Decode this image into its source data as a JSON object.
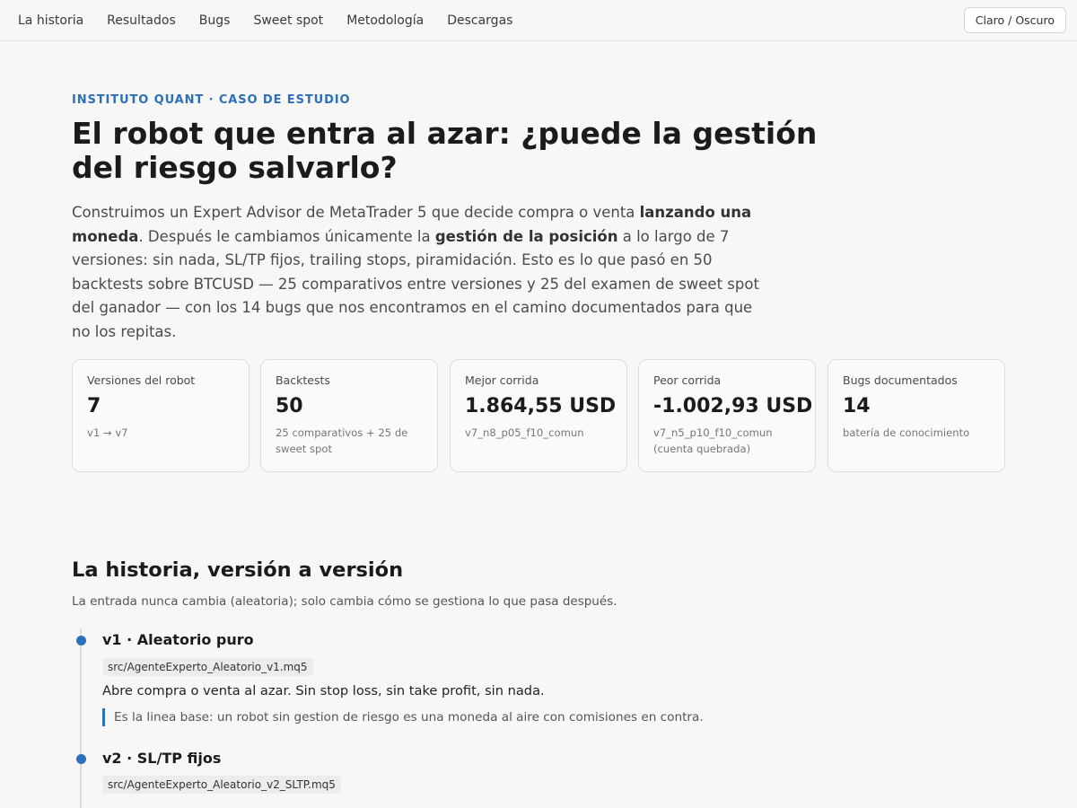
{
  "nav": {
    "links": [
      "La historia",
      "Resultados",
      "Bugs",
      "Sweet spot",
      "Metodología",
      "Descargas"
    ],
    "theme_toggle": "Claro / Oscuro"
  },
  "hero": {
    "eyebrow": "INSTITUTO QUANT · CASO DE ESTUDIO",
    "title": "El robot que entra al azar: ¿puede la gestión del riesgo salvarlo?",
    "lead": {
      "p1": "Construimos un Expert Advisor de MetaTrader 5 que decide compra o venta ",
      "b1": "lanzando una moneda",
      "p2": ". Después le cambiamos únicamente la ",
      "b2": "gestión de la posición",
      "p3": " a lo largo de 7 versiones: sin nada, SL/TP fijos, trailing stops, piramidación. Esto es lo que pasó en 50 backtests sobre BTCUSD — 25 comparativos entre versiones y 25 del examen de sweet spot del ganador — con los 14 bugs que nos encontramos en el camino documentados para que no los repitas."
    }
  },
  "stats": [
    {
      "label": "Versiones del robot",
      "value": "7",
      "sub": "v1 → v7"
    },
    {
      "label": "Backtests",
      "value": "50",
      "sub": "25 comparativos + 25 de sweet spot"
    },
    {
      "label": "Mejor corrida",
      "value": "1.864,55 USD",
      "sub": "v7_n8_p05_f10_comun"
    },
    {
      "label": "Peor corrida",
      "value": "-1.002,93 USD",
      "sub": "v7_n5_p10_f10_comun (cuenta quebrada)"
    },
    {
      "label": "Bugs documentados",
      "value": "14",
      "sub": "batería de conocimiento"
    }
  ],
  "history": {
    "title": "La historia, versión a versión",
    "subtitle": "La entrada nunca cambia (aleatoria); solo cambia cómo se gestiona lo que pasa después.",
    "versions": [
      {
        "title": "v1 · Aleatorio puro",
        "file": "src/AgenteExperto_Aleatorio_v1.mq5",
        "desc": "Abre compra o venta al azar. Sin stop loss, sin take profit, sin nada.",
        "note": "Es la linea base: un robot sin gestion de riesgo es una moneda al aire con comisiones en contra."
      },
      {
        "title": "v2 · SL/TP fijos",
        "file": "src/AgenteExperto_Aleatorio_v2_SLTP.mq5"
      }
    ]
  },
  "colors": {
    "accent": "#2d6fb8",
    "background": "#f7f7f6",
    "card_border": "#dddddb"
  }
}
